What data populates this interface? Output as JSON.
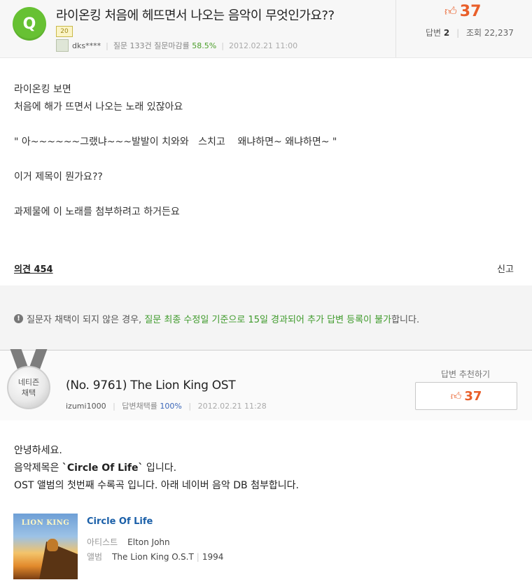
{
  "question": {
    "badge": "Q",
    "title": "라이온킹 처음에 헤뜨면서 나오는 음악이 무엇인가요??",
    "level": "20",
    "author": "dks****",
    "stats_count": "질문 133건",
    "close_rate_label": "질문마감률",
    "close_rate": "58.5%",
    "date": "2012.02.21  11:00",
    "votes": "37",
    "answers_label": "답변",
    "answers_count": "2",
    "views_label": "조회",
    "views_count": "22,237",
    "body": [
      "라이온킹 보면",
      "처음에 해가 뜨면서 나오는 노래 있잖아요",
      "",
      "\" 아~~~~~~그랬냐~~~발발이 치와와   스치고    왜냐하면~ 왜냐하면~ \"",
      "",
      "이거 제목이 뭔가요??",
      "",
      "과제물에 이 노래를 첨부하려고 하거든요"
    ],
    "comments_label": "의견 454",
    "report_label": "신고"
  },
  "notice": {
    "prefix": "질문자 채택이 되지 않은 경우,",
    "highlight": "질문 최종 수정일 기준으로 15일 경과되어 추가 답변 등록이 불가",
    "suffix": "합니다."
  },
  "answer": {
    "medal_line1": "네티즌",
    "medal_line2": "채택",
    "title": "(No. 9761) The Lion King OST",
    "author": "izumi1000",
    "adopt_rate_label": "답변채택률",
    "adopt_rate": "100%",
    "date": "2012.02.21  11:28",
    "recommend_label": "답변 추천하기",
    "votes": "37",
    "line1": "안녕하세요.",
    "line2_prefix": "음악제목은 ",
    "line2_bold": "`Circle Of Life`",
    "line2_suffix": " 입니다.",
    "line3": "OST 앨범의 첫번째 수록곡 입니다. 아래 네이버 음악 DB 첨부합니다.",
    "album_art_text": "LION KING",
    "song": {
      "title": "Circle Of Life",
      "artist_label": "아티스트",
      "artist": "Elton John",
      "album_label": "앨범",
      "album": "The Lion King O.S.T",
      "year": "1994"
    }
  },
  "colors": {
    "q_badge": "#67c133",
    "vote": "#e95f2a",
    "green_text": "#3e9a2a",
    "link_blue": "#1a5fa8"
  },
  "icons": [
    "thumbs-up-icon",
    "info-icon",
    "medal-icon"
  ]
}
